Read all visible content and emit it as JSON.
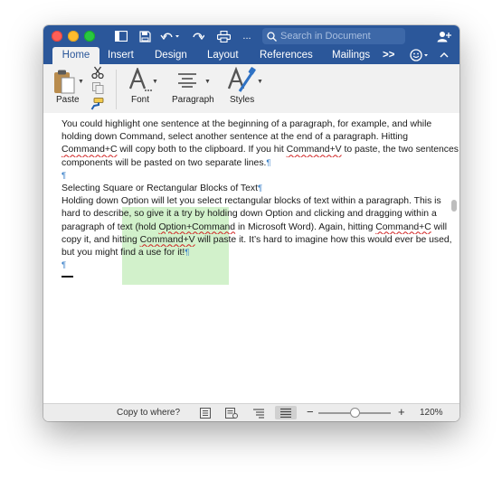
{
  "window": {
    "search_placeholder": "Search in Document",
    "more_label": "...",
    "tabs": [
      {
        "label": "Home"
      },
      {
        "label": "Insert"
      },
      {
        "label": "Design"
      },
      {
        "label": "Layout"
      },
      {
        "label": "References"
      },
      {
        "label": "Mailings"
      }
    ],
    "tabs_overflow": ">>"
  },
  "ribbon": {
    "paste_label": "Paste",
    "font_label": "Font",
    "paragraph_label": "Paragraph",
    "styles_label": "Styles"
  },
  "document": {
    "para1": {
      "l1": "You could highlight one sentence at the beginning of a paragraph, for example, and while",
      "l2": "holding down Command, select another sentence at the end of a paragraph. Hitting",
      "l3a": "Command+C",
      "l3b": " will copy both to the clipboard. If you hit ",
      "l3c": "Command+V",
      "l3d": " to paste, the two sentences",
      "l4": "components will be pasted on two separate lines."
    },
    "heading": "Selecting Square or Rectangular Blocks of Text",
    "para2": {
      "l1": "Holding down Option will let you select rectangular blocks of text within a paragraph. This is",
      "l2": "hard to describe, so give it a try by holding down Option and clicking and dragging within a",
      "l3a": "paragraph of text (hold ",
      "l3b": "Option+Command",
      "l3c": " in Microsoft Word). Again, hitting ",
      "l3d": "Command+C",
      "l3e": " will",
      "l4a": "copy it, and hitting ",
      "l4b": "Command+V",
      "l4c": " will paste it. It’s hard to imagine how this would ever be used,",
      "l5": "but you might find a use for it!"
    },
    "pilcrow": "¶"
  },
  "status": {
    "copy_to": "Copy to where?",
    "zoom_minus": "−",
    "zoom_plus": "+",
    "zoom": "120%",
    "zoom_level_fraction": 0.5
  },
  "colors": {
    "brand": "#2b579a",
    "highlight": "#c5edbc",
    "pilcrow": "#3c82c9"
  }
}
